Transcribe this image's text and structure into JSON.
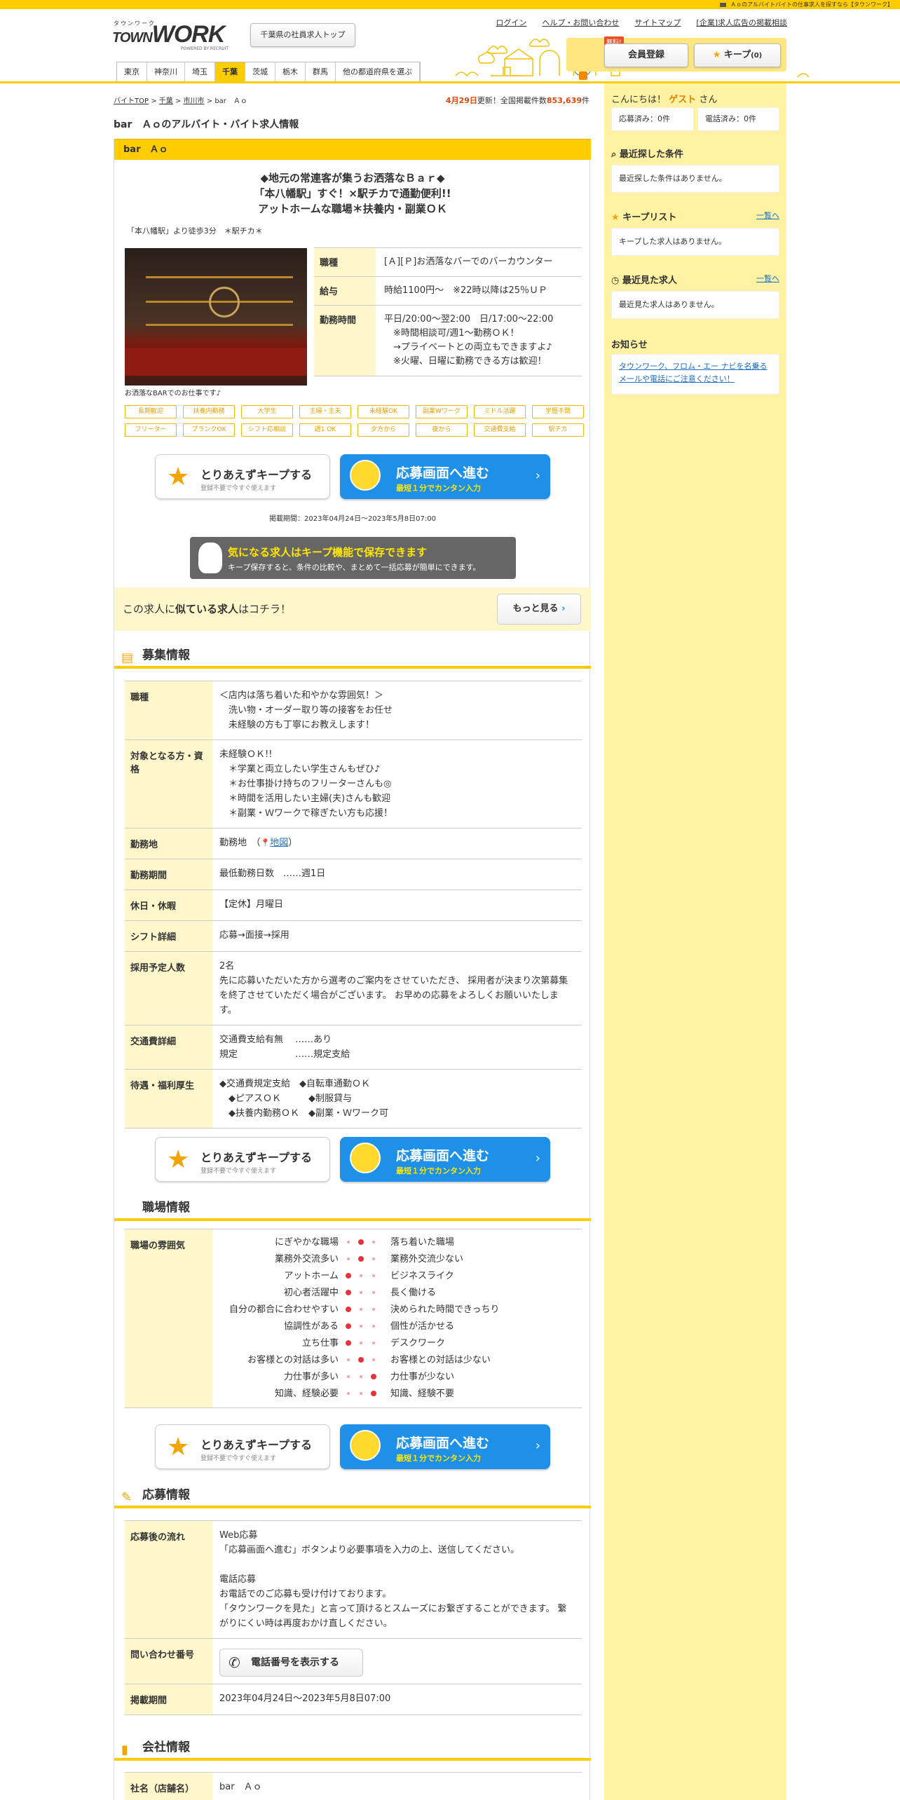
{
  "top_note": "Ａｏのアルバイトバイトの仕事求人を探すなら【タウンワーク】",
  "logo": {
    "kana": "タウンワーク",
    "word": "WORK",
    "prefix": "TOWN",
    "powered": "POWERED BY RECRUIT"
  },
  "header": {
    "region_button": "千葉県の社員求人トップ",
    "links": [
      "ログイン",
      "ヘルプ・お問い合わせ",
      "サイトマップ",
      "[企業]求人広告の掲載相談"
    ],
    "free_badge": "無料!",
    "member_button": "会員登録",
    "keep_button": "キープ",
    "keep_count": "(0)"
  },
  "nav_tabs": [
    "東京",
    "神奈川",
    "埼玉",
    "千葉",
    "茨城",
    "栃木",
    "群馬",
    "他の都道府県を選ぶ"
  ],
  "breadcrumb": [
    "バイトTOP",
    ">",
    "千葉",
    ">",
    "市川市",
    ">",
    "bar　Ａｏ"
  ],
  "update": {
    "date": "4月29日",
    "text": "更新！全国掲載件数",
    "count": "853,639",
    "unit": "件"
  },
  "page_title": "bar　Ａｏのアルバイト・バイト求人情報",
  "job": {
    "title": "bar　Ａｏ",
    "catch": [
      "◆地元の常連客が集うお洒落なＢａｒ◆",
      "「本八幡駅」すぐ！×駅チカで通勤便利!!",
      "アットホームな職場＊扶養内・副業ＯＫ"
    ],
    "station": "「本八幡駅」より徒歩3分　＊駅チカ＊",
    "photo_caption": "お洒落なBARでのお仕事です♪",
    "summary": [
      {
        "h": "職種",
        "v": "[Ａ][Ｐ]お洒落なバーでのバーカウンター"
      },
      {
        "h": "給与",
        "v": "時給1100円～　※22時以降は25％ＵＰ"
      },
      {
        "h": "勤務時間",
        "v": "平日/20:00～翌2:00　日/17:00～22:00\n　※時間相談可/週1～勤務ＯＫ！\n　→プライベートとの両立もできますよ♪\n　※火曜、日曜に勤務できる方は歓迎！"
      }
    ],
    "tags": [
      "長期歓迎",
      "扶養内勤務",
      "大学生",
      "主婦・主夫",
      "未経験OK",
      "副業Wワーク",
      "ミドル活躍",
      "学歴不問",
      "フリーター",
      "ブランクOK",
      "シフト応相談",
      "週1 OK",
      "夕方から",
      "夜から",
      "交通費支給",
      "駅チカ"
    ],
    "period": "掲載期間：2023年04月24日～2023年5月8日07:00"
  },
  "buttons": {
    "keep_l1": "とりあえずキープする",
    "keep_l2": "登録不要で今すぐ使えます",
    "apply_l1": "応募画面へ進む",
    "apply_l2": "最短１分でカンタン入力"
  },
  "keep_info": {
    "l1": "気になる求人はキープ機能で保存できます",
    "l2": "キープ保存すると、条件の比較や、まとめて一括応募が簡単にできます。"
  },
  "similar": {
    "pre": "この求人に",
    "bold": "似ている求人",
    "post": "はコチラ！",
    "more": "もっと見る"
  },
  "sections": {
    "recruit": "募集情報",
    "workplace": "職場情報",
    "apply": "応募情報",
    "company": "会社情報"
  },
  "recruit_rows": [
    {
      "h": "職種",
      "v": "＜店内は落ち着いた和やかな雰囲気！＞\n　洗い物・オーダー取り等の接客をお任せ\n　未経験の方も丁寧にお教えします！"
    },
    {
      "h": "対象となる方・資格",
      "v": "未経験ＯＫ!!\n　＊学業と両立したい学生さんもぜひ♪\n　＊お仕事掛け持ちのフリーターさんも◎\n　＊時間を活用したい主婦(夫)さんも歓迎\n　＊副業・Ｗワークで稼ぎたい方も応援！"
    },
    {
      "h": "勤務地",
      "v": "勤務地　（",
      "link": "地図",
      "close": "）"
    },
    {
      "h": "勤務期間",
      "v": "最低勤務日数　……週1日"
    },
    {
      "h": "休日・休暇",
      "v": "【定休】月曜日"
    },
    {
      "h": "シフト詳細",
      "v": "応募→面接→採用"
    },
    {
      "h": "採用予定人数",
      "v": "2名\n先に応募いただいた方から選考のご案内をさせていただき、 採用者が決まり次第募集を終了させていただく場合がございます。 お早めの応募をよろしくお願いいたします。"
    },
    {
      "h": "交通費詳細",
      "v": "交通費支給有無　 ……あり\n規定　　　　　　 ……規定支給"
    },
    {
      "h": "待遇・福利厚生",
      "v": "◆交通費規定支給　◆自転車通勤ＯＫ\n　◆ピアスＯＫ　　　◆制服貸与\n　◆扶養内勤務ＯＫ　◆副業・Ｗワーク可"
    }
  ],
  "atmosphere": {
    "h": "職場の雰囲気",
    "rows": [
      {
        "l": "にぎやかな職場",
        "r": "落ち着いた職場",
        "pos": 2
      },
      {
        "l": "業務外交流多い",
        "r": "業務外交流少ない",
        "pos": 2
      },
      {
        "l": "アットホーム",
        "r": "ビジネスライク",
        "pos": 1
      },
      {
        "l": "初心者活躍中",
        "r": "長く働ける",
        "pos": 1
      },
      {
        "l": "自分の都合に合わせやすい",
        "r": "決められた時間できっちり",
        "pos": 1
      },
      {
        "l": "協調性がある",
        "r": "個性が活かせる",
        "pos": 1
      },
      {
        "l": "立ち仕事",
        "r": "デスクワーク",
        "pos": 1
      },
      {
        "l": "お客様との対話は多い",
        "r": "お客様との対話は少ない",
        "pos": 2
      },
      {
        "l": "力仕事が多い",
        "r": "力仕事が少ない",
        "pos": 3
      },
      {
        "l": "知識、経験必要",
        "r": "知識、経験不要",
        "pos": 3
      }
    ]
  },
  "apply_rows": [
    {
      "h": "応募後の流れ",
      "v": "Web応募\n「応募画面へ進む」ボタンより必要事項を入力の上、送信してください。\n\n電話応募\nお電話でのご応募も受け付けております。\n「タウンワークを見た」と言って頂けるとスムーズにお繋ぎすることができます。 繋がりにくい時は再度おかけ直しください。"
    },
    {
      "h": "問い合わせ番号",
      "btn": "電話番号を表示する"
    },
    {
      "h": "掲載期間",
      "v": "2023年04月24日～2023年5月8日07:00"
    }
  ],
  "company_rows": [
    {
      "h": "社名（店舗名）",
      "v": "bar　Ａｏ"
    }
  ],
  "sidebar": {
    "greet_pre": "こんにちは！",
    "guest": "ゲスト",
    "greet_post": "さん",
    "applied": "応募済み：0件",
    "called": "電話済み：0件",
    "recent_cond": "最近探した条件",
    "recent_cond_empty": "最近探した条件はありません。",
    "keep_list": "キープリスト",
    "keep_link": "一覧へ",
    "keep_empty": "キープした求人はありません。",
    "recent_view": "最近見た求人",
    "recent_link": "一覧へ",
    "recent_empty": "最近見た求人はありません。",
    "notice": "お知らせ",
    "notice_link": "タウンワーク、フロム・エー ナビを名乗るメールや電話にご注意ください！"
  }
}
